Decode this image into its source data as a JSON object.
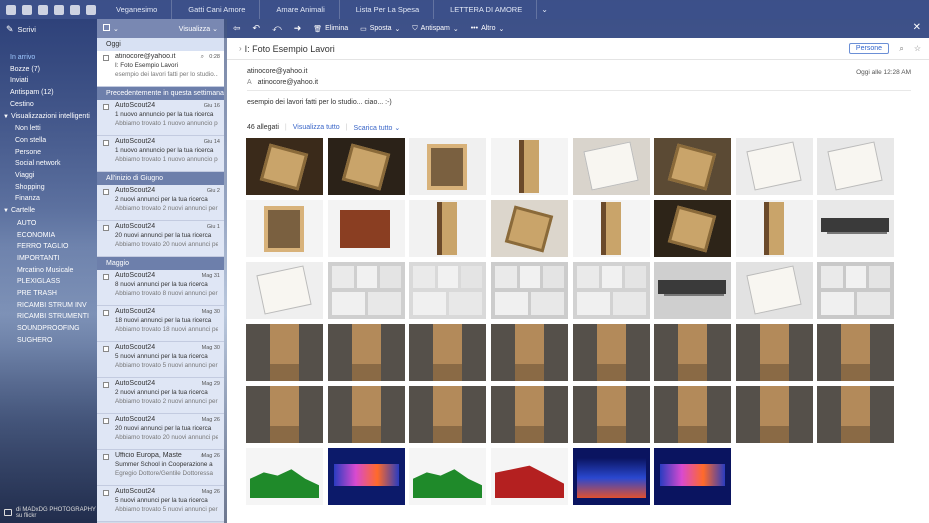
{
  "topbar": {
    "tabs": [
      "Veganesimo",
      "Gatti Cani Amore",
      "Amare Animali",
      "Lista Per La Spesa",
      "LETTERA DI AMORE"
    ]
  },
  "sidebar": {
    "compose_label": "Scrivi",
    "items": [
      {
        "label": "In arrivo",
        "kind": "active"
      },
      {
        "label": "Bozze (7)",
        "kind": "top"
      },
      {
        "label": "Inviati",
        "kind": "top"
      },
      {
        "label": "Antispam (12)",
        "kind": "top"
      },
      {
        "label": "Cestino",
        "kind": "top"
      },
      {
        "label": "Visualizzazioni intelligenti",
        "kind": "section"
      },
      {
        "label": "Non letti",
        "kind": "sub"
      },
      {
        "label": "Con stella",
        "kind": "sub"
      },
      {
        "label": "Persone",
        "kind": "sub"
      },
      {
        "label": "Social network",
        "kind": "sub"
      },
      {
        "label": "Viaggi",
        "kind": "sub"
      },
      {
        "label": "Shopping",
        "kind": "sub"
      },
      {
        "label": "Finanza",
        "kind": "sub"
      },
      {
        "label": "Cartelle",
        "kind": "section"
      },
      {
        "label": "AUTO",
        "kind": "folder"
      },
      {
        "label": "ECONOMIA",
        "kind": "folder"
      },
      {
        "label": "FERRO TAGLIO",
        "kind": "folder"
      },
      {
        "label": "IMPORTANTI",
        "kind": "folder"
      },
      {
        "label": "Mrcatino Musicale",
        "kind": "folder"
      },
      {
        "label": "PLEXIGLASS",
        "kind": "folder"
      },
      {
        "label": "PRE TRASH",
        "kind": "folder"
      },
      {
        "label": "RICAMBI STRUM INV",
        "kind": "folder"
      },
      {
        "label": "RICAMBI STRUMENTI",
        "kind": "folder"
      },
      {
        "label": "SOUNDPROOFING",
        "kind": "folder"
      },
      {
        "label": "SUGHERO",
        "kind": "folder"
      }
    ],
    "credit_line1": "di MADxDG PHOTOGRAPHY",
    "credit_line2": "su flickr"
  },
  "msglist": {
    "view_label": "Visualizza",
    "groups": [
      {
        "title": "Oggi",
        "style": "today",
        "messages": [
          {
            "from": "atinocore@yahoo.it",
            "date": "0:28",
            "subject": "I: Foto Esempio Lavori",
            "preview": "esempio dei lavori fatti per lo studio...",
            "selected": true,
            "attachment": true
          }
        ]
      },
      {
        "title": "Precedentemente in questa settimana",
        "style": "dark",
        "messages": [
          {
            "from": "AutoScout24",
            "date": "Giu 16",
            "subject": "1 nuovo annuncio per la tua ricerca",
            "preview": "Abbiamo trovato 1 nuovo annuncio per la"
          },
          {
            "from": "AutoScout24",
            "date": "Giu 14",
            "subject": "1 nuovo annuncio per la tua ricerca",
            "preview": "Abbiamo trovato 1 nuovo annuncio per la"
          }
        ]
      },
      {
        "title": "All'inizio di Giugno",
        "style": "dark",
        "messages": [
          {
            "from": "AutoScout24",
            "date": "Giu 2",
            "subject": "2 nuovi annunci per la tua ricerca",
            "preview": "Abbiamo trovato 2 nuovi annunci per la"
          },
          {
            "from": "AutoScout24",
            "date": "Giu 1",
            "subject": "20 nuovi annunci per la tua ricerca",
            "preview": "Abbiamo trovato 20 nuovi annunci per la"
          }
        ]
      },
      {
        "title": "Maggio",
        "style": "dark",
        "messages": [
          {
            "from": "AutoScout24",
            "date": "Mag 31",
            "subject": "8 nuovi annunci per la tua ricerca",
            "preview": "Abbiamo trovato 8 nuovi annunci per la"
          },
          {
            "from": "AutoScout24",
            "date": "Mag 30",
            "subject": "18 nuovi annunci per la tua ricerca",
            "preview": "Abbiamo trovato 18 nuovi annunci per la"
          },
          {
            "from": "AutoScout24",
            "date": "Mag 30",
            "subject": "5 nuovi annunci per la tua ricerca",
            "preview": "Abbiamo trovato 5 nuovi annunci per la"
          },
          {
            "from": "AutoScout24",
            "date": "Mag 29",
            "subject": "2 nuovi annunci per la tua ricerca",
            "preview": "Abbiamo trovato 2 nuovi annunci per la"
          },
          {
            "from": "AutoScout24",
            "date": "Mag 26",
            "subject": "20 nuovi annunci per la tua ricerca",
            "preview": "Abbiamo trovato 20 nuovi annunci per la"
          },
          {
            "from": "Ufficio Europa, Maste",
            "date": "Mag 26",
            "subject": "Summer School in Cooperazione a",
            "preview": "Egregio Dottore/Gentile Dottoressa",
            "attachment": true
          },
          {
            "from": "AutoScout24",
            "date": "Mag 26",
            "subject": "5 nuovi annunci per la tua ricerca",
            "preview": "Abbiamo trovato 5 nuovi annunci per la"
          }
        ]
      }
    ]
  },
  "toolbar": {
    "delete_label": "Elimina",
    "move_label": "Sposta",
    "spam_label": "Antispam",
    "more_label": "Altro"
  },
  "reader": {
    "subject": "I: Foto Esempio Lavori",
    "persone_label": "Persone",
    "from": "atinocore@yahoo.it",
    "to_prefix": "A",
    "to": "atinocore@yahoo.it",
    "date": "Oggi alle 12:28 AM",
    "body": "esempio dei lavori fatti per lo studio... ciao... :-)",
    "attachments_count": "46 allegati",
    "view_all_label": "Visualizza tutto",
    "download_all_label": "Scarica tutto"
  },
  "attachments": [
    {
      "kind": "wood",
      "bg": "#3a2a1a"
    },
    {
      "kind": "wood",
      "bg": "#2b2218"
    },
    {
      "kind": "box",
      "bg": "#f0f0f0"
    },
    {
      "kind": "pillar",
      "bg": "#f4f4f4"
    },
    {
      "kind": "white",
      "bg": "#d9d4cc"
    },
    {
      "kind": "wood",
      "bg": "#5b4a34"
    },
    {
      "kind": "white",
      "bg": "#ececec"
    },
    {
      "kind": "white",
      "bg": "#e8e8e8"
    },
    {
      "kind": "box",
      "bg": "#f4f4f4"
    },
    {
      "kind": "brown",
      "bg": "#f3f3f3"
    },
    {
      "kind": "pillar",
      "bg": "#f2f2f2"
    },
    {
      "kind": "wood",
      "bg": "#dcd6cc"
    },
    {
      "kind": "pillar",
      "bg": "#f4f4f4"
    },
    {
      "kind": "wood",
      "bg": "#2d2418"
    },
    {
      "kind": "pillar",
      "bg": "#f2f2f2"
    },
    {
      "kind": "mic",
      "bg": "#e8e8e8"
    },
    {
      "kind": "white",
      "bg": "#efefef"
    },
    {
      "kind": "collage",
      "bg": "#cfcfcf"
    },
    {
      "kind": "collage",
      "bg": "#d9d9d9"
    },
    {
      "kind": "collage",
      "bg": "#cccccc"
    },
    {
      "kind": "collage",
      "bg": "#d2d2d2"
    },
    {
      "kind": "mic",
      "bg": "#cfcfcf"
    },
    {
      "kind": "white",
      "bg": "#e2e2e2"
    },
    {
      "kind": "collage",
      "bg": "#c9c9c9"
    },
    {
      "kind": "room",
      "bg": "#3b3b3b"
    },
    {
      "kind": "room",
      "bg": "#403c38"
    },
    {
      "kind": "room",
      "bg": "#383838"
    },
    {
      "kind": "room",
      "bg": "#3d3b38"
    },
    {
      "kind": "room",
      "bg": "#3a3a3a"
    },
    {
      "kind": "room",
      "bg": "#3e3c38"
    },
    {
      "kind": "room",
      "bg": "#393939"
    },
    {
      "kind": "room",
      "bg": "#3c3a37"
    },
    {
      "kind": "room",
      "bg": "#3b3b3b"
    },
    {
      "kind": "room",
      "bg": "#403c38"
    },
    {
      "kind": "room",
      "bg": "#3a3a3a"
    },
    {
      "kind": "room",
      "bg": "#3d3b38"
    },
    {
      "kind": "room",
      "bg": "#3a3a3a"
    },
    {
      "kind": "room",
      "bg": "#3e3c38"
    },
    {
      "kind": "room",
      "bg": "#393939"
    },
    {
      "kind": "room",
      "bg": "#3c3a37"
    },
    {
      "kind": "green",
      "bg": "#f5f5f5"
    },
    {
      "kind": "spectrum",
      "bg": "#0c1a6a"
    },
    {
      "kind": "green",
      "bg": "#f5f5f5"
    },
    {
      "kind": "red",
      "bg": "#f5f5f5"
    },
    {
      "kind": "spectrum2",
      "bg": "#0a1460"
    },
    {
      "kind": "spectrum",
      "bg": "#0a1460"
    }
  ]
}
